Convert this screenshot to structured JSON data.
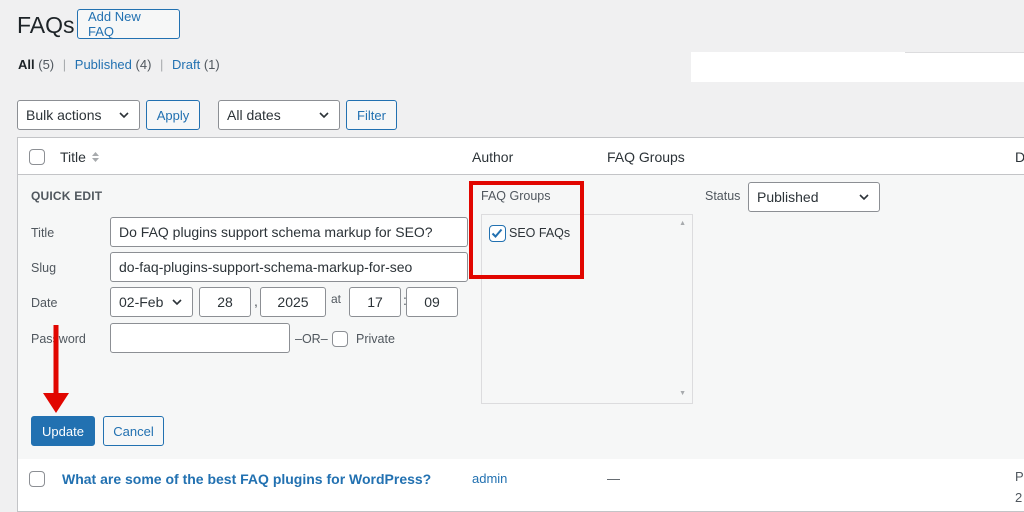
{
  "header": {
    "title": "FAQs",
    "add_new_label": "Add New FAQ"
  },
  "filters": {
    "all": {
      "label": "All",
      "count": "(5)"
    },
    "published": {
      "label": "Published",
      "count": "(4)"
    },
    "draft": {
      "label": "Draft",
      "count": "(1)"
    },
    "separator": "|"
  },
  "toolbar": {
    "bulk_actions": "Bulk actions",
    "apply_label": "Apply",
    "dates": "All dates",
    "filter_label": "Filter"
  },
  "table": {
    "columns": {
      "title": "Title",
      "author": "Author",
      "groups": "FAQ Groups",
      "date_initial": "D"
    },
    "rows": [
      {
        "title": "What are some of the best FAQ plugins for WordPress?",
        "author": "admin",
        "groups": "—",
        "date_initial": "P",
        "date_year_partial": "2"
      }
    ]
  },
  "quick_edit": {
    "heading": "QUICK EDIT",
    "title_label": "Title",
    "title_value": "Do FAQ plugins support schema markup for SEO?",
    "slug_label": "Slug",
    "slug_value": "do-faq-plugins-support-schema-markup-for-seo",
    "date_label": "Date",
    "month": "02-Feb",
    "day": "28",
    "comma": ",",
    "year": "2025",
    "at": "at",
    "hour": "17",
    "colon": ":",
    "minute": "09",
    "password_label": "Password",
    "or_label": "–OR–",
    "private_label": "Private",
    "groups_label": "FAQ Groups",
    "group_option": "SEO FAQs",
    "group_checked": true,
    "status_label": "Status",
    "status_value": "Published",
    "update_label": "Update",
    "cancel_label": "Cancel"
  },
  "colors": {
    "accent": "#2271b1",
    "annotation": "#e10600"
  }
}
